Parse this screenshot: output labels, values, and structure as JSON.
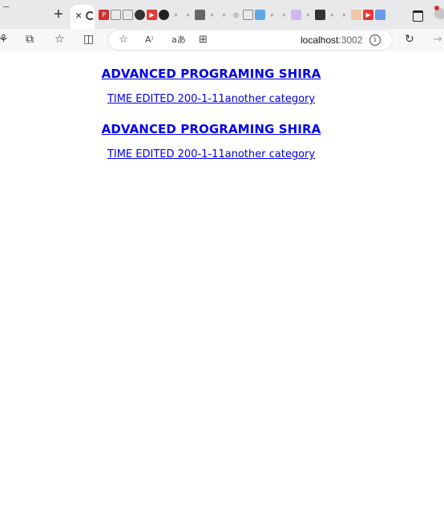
{
  "browser": {
    "address_bar": {
      "host": "localhost",
      "port": ":3002"
    },
    "new_tab_label": "+",
    "close_tab_label": "×"
  },
  "posts": [
    {
      "title": "ADVANCED PROGRAMING SHIRA",
      "meta": "TIME EDITED 200-1-11another category"
    },
    {
      "title": "ADVANCED PROGRAMING SHIRA",
      "meta": "TIME EDITED 200-1-11another category"
    }
  ],
  "colors": {
    "link": "#0000ee",
    "chrome": "#e9e9ec",
    "toolbar": "#f7f7f7"
  }
}
